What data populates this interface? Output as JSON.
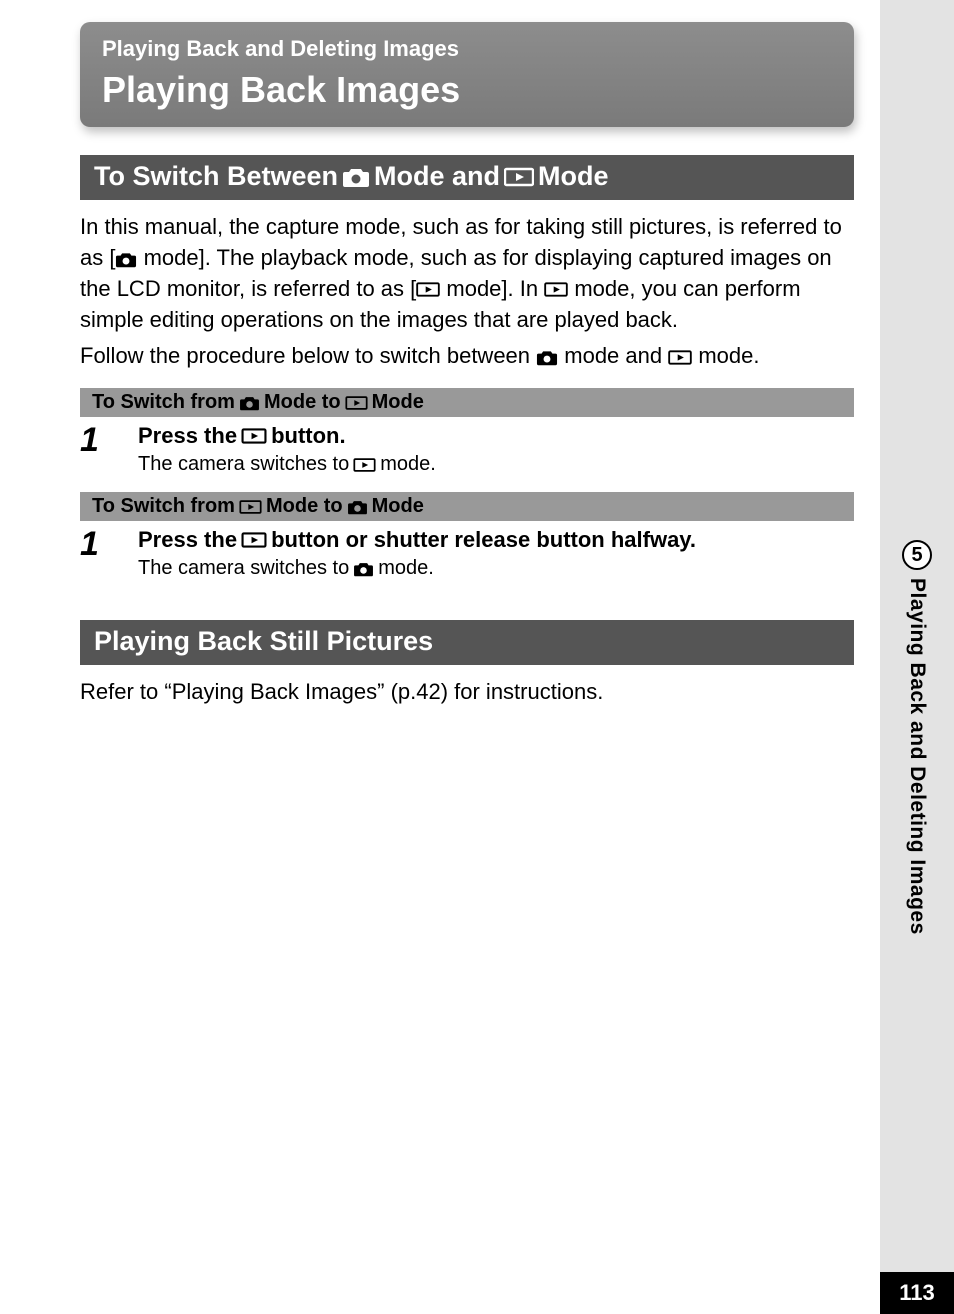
{
  "header": {
    "eyebrow": "Playing Back and Deleting Images",
    "title": "Playing Back Images"
  },
  "section1": {
    "heading_parts": [
      "To Switch Between ",
      " Mode and ",
      " Mode"
    ],
    "para_parts": [
      "In this manual, the capture mode, such as for taking still pictures, is referred to as [",
      " mode]. The playback mode, such as for displaying captured images on the LCD monitor, is referred to as [",
      " mode]. In ",
      " mode, you can perform simple editing operations on the images that are played back."
    ],
    "follow_parts": [
      "Follow the procedure below to switch between ",
      " mode and ",
      " mode."
    ],
    "sub1": {
      "heading_parts": [
        "To Switch from ",
        " Mode to ",
        " Mode"
      ],
      "step_num": "1",
      "instr_parts": [
        "Press the ",
        " button."
      ],
      "result_parts": [
        "The camera switches to ",
        " mode."
      ]
    },
    "sub2": {
      "heading_parts": [
        "To Switch from ",
        " Mode to ",
        " Mode"
      ],
      "step_num": "1",
      "instr_parts": [
        "Press the ",
        " button or shutter release button halfway."
      ],
      "result_parts": [
        "The camera switches to ",
        " mode."
      ]
    }
  },
  "section2": {
    "heading": "Playing Back Still Pictures",
    "body": "Refer to “Playing Back Images” (p.42) for instructions."
  },
  "sidebar": {
    "chapter_number": "5",
    "chapter_title": "Playing Back and Deleting Images"
  },
  "page_number": "113"
}
